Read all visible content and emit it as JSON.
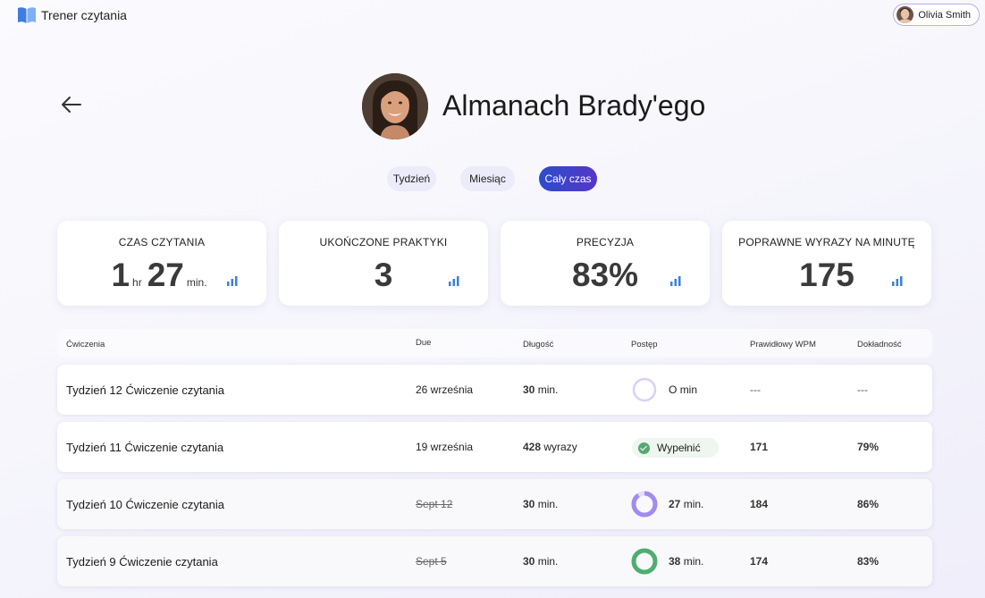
{
  "app": {
    "title": "Trener czytania",
    "logo_icon": "book-icon"
  },
  "user": {
    "name": "Olivia Smith"
  },
  "profile": {
    "name": "Almanach Brady'ego"
  },
  "tabs": [
    {
      "label": "Tydzień",
      "active": false
    },
    {
      "label": "Miesiąc",
      "active": false
    },
    {
      "label": "Cały czas",
      "active": true
    }
  ],
  "stats": [
    {
      "label": "CZAS CZYTANIA",
      "hours": "1",
      "hours_unit": "hr",
      "minutes": "27",
      "minutes_unit": "min."
    },
    {
      "label": "UKOŃCZONE PRAKTYKI",
      "value": "3"
    },
    {
      "label": "PRECYZJA",
      "value": "83%"
    },
    {
      "label": "POPRAWNE WYRAZY NA MINUTĘ",
      "value": "175"
    }
  ],
  "table": {
    "headers": {
      "exercise": "Ćwiczenia",
      "due": "Due",
      "length": "Długość",
      "progress": "Postęp",
      "wpm": "Prawidłowy WPM",
      "accuracy": "Dokładność"
    },
    "rows": [
      {
        "title": "Tydzień 12 Ćwiczenie czytania",
        "due": "26 września",
        "length_value": "30",
        "length_unit": "min.",
        "progress_value": "O",
        "progress_unit": "min",
        "progress_fraction": 0,
        "wpm": "---",
        "accuracy": "---"
      },
      {
        "title": "Tydzień 11 Ćwiczenie czytania",
        "due": "19 września",
        "length_value": "428",
        "length_unit": "wyrazy",
        "status": "Wypełnić",
        "wpm": "171",
        "accuracy": "79%"
      },
      {
        "title": "Tydzień 10 Ćwiczenie czytania",
        "due": "Sept 12",
        "length_value": "30",
        "length_unit": "min.",
        "progress_value": "27",
        "progress_unit": "min.",
        "progress_fraction": 0.9,
        "wpm": "184",
        "accuracy": "86%"
      },
      {
        "title": "Tydzień 9 Ćwiczenie czytania",
        "due": "Sept 5",
        "length_value": "30",
        "length_unit": "min.",
        "progress_value": "38",
        "progress_unit": "min.",
        "progress_fraction": 1.0,
        "wpm": "174",
        "accuracy": "83%"
      }
    ]
  },
  "colors": {
    "accent": "#4a3fd0",
    "progress_purple": "#a08cf0",
    "progress_green": "#4fae6e",
    "complete_green": "#55a872"
  }
}
